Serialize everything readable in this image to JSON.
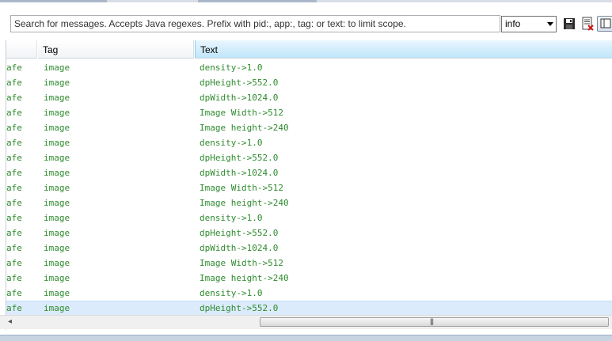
{
  "search": {
    "placeholder": "Search for messages. Accepts Java regexes. Prefix with pid:, app:, tag: or text: to limit scope.",
    "value": ""
  },
  "level_select": {
    "selected": "info"
  },
  "icons": {
    "save": "save-icon",
    "clear": "clear-log-icon",
    "toggle": "toggle-panel-icon",
    "scroll_left": "chevron-left-icon",
    "scroll_grip": "grip-icon"
  },
  "table": {
    "columns": {
      "app": "",
      "tag": "Tag",
      "text": "Text"
    },
    "rows": [
      {
        "app": "afe",
        "tag": "image",
        "text": "density->1.0"
      },
      {
        "app": "afe",
        "tag": "image",
        "text": "dpHeight->552.0"
      },
      {
        "app": "afe",
        "tag": "image",
        "text": "dpWidth->1024.0"
      },
      {
        "app": "afe",
        "tag": "image",
        "text": "Image Width->512"
      },
      {
        "app": "afe",
        "tag": "image",
        "text": "Image height->240"
      },
      {
        "app": "afe",
        "tag": "image",
        "text": "density->1.0"
      },
      {
        "app": "afe",
        "tag": "image",
        "text": "dpHeight->552.0"
      },
      {
        "app": "afe",
        "tag": "image",
        "text": "dpWidth->1024.0"
      },
      {
        "app": "afe",
        "tag": "image",
        "text": "Image Width->512"
      },
      {
        "app": "afe",
        "tag": "image",
        "text": "Image height->240"
      },
      {
        "app": "afe",
        "tag": "image",
        "text": "density->1.0"
      },
      {
        "app": "afe",
        "tag": "image",
        "text": "dpHeight->552.0"
      },
      {
        "app": "afe",
        "tag": "image",
        "text": "dpWidth->1024.0"
      },
      {
        "app": "afe",
        "tag": "image",
        "text": "Image Width->512"
      },
      {
        "app": "afe",
        "tag": "image",
        "text": "Image height->240"
      },
      {
        "app": "afe",
        "tag": "image",
        "text": "density->1.0"
      },
      {
        "app": "afe",
        "tag": "image",
        "text": "dpHeight->552.0",
        "selected": true
      }
    ]
  },
  "colors": {
    "log_text": "#2e8b2e",
    "header_active": "#bfe6fb",
    "selection": "#dcebfc"
  }
}
